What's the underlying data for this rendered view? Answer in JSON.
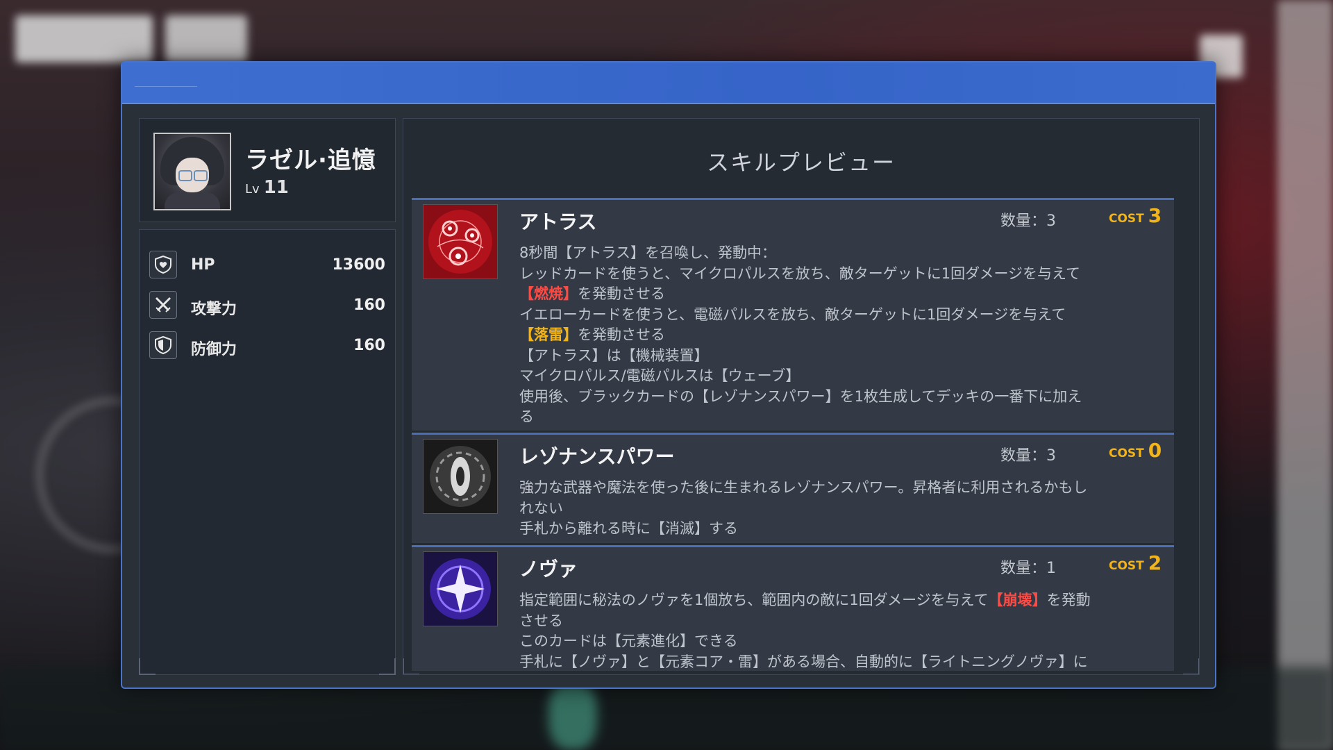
{
  "character": {
    "name": "ラゼル·追憶",
    "level_label": "Lv",
    "level": "11"
  },
  "stats": [
    {
      "icon": "heart-shield-icon",
      "label": "HP",
      "value": "13600"
    },
    {
      "icon": "crossed-swords-icon",
      "label": "攻撃力",
      "value": "160"
    },
    {
      "icon": "shield-icon",
      "label": "防御力",
      "value": "160"
    }
  ],
  "panel_title": "スキルプレビュー",
  "skills": [
    {
      "name": "アトラス",
      "qty_label": "数量：3",
      "cost_label": "COST",
      "cost": "3",
      "icon": "atlas-orbs-icon",
      "desc": {
        "l1": "8秒間【アトラス】を召喚し、発動中：",
        "l2": "レッドカードを使うと、マイクロパルスを放ち、敵ターゲットに1回ダメージを与えて",
        "l3a": "【燃焼】",
        "l3b": "を発動させる",
        "l4": "イエローカードを使うと、電磁パルスを放ち、敵ターゲットに1回ダメージを与えて",
        "l5a": "【落雷】",
        "l5b": "を発動させる",
        "l6": "【アトラス】は【機械装置】",
        "l7": "マイクロパルス/電磁パルスは【ウェーブ】",
        "l8": "使用後、ブラックカードの【レゾナンスパワー】を1枚生成してデッキの一番下に加え",
        "l9": "る"
      }
    },
    {
      "name": "レゾナンスパワー",
      "qty_label": "数量：3",
      "cost_label": "COST",
      "cost": "0",
      "icon": "resonance-eye-icon",
      "desc": {
        "l1": "強力な武器や魔法を使った後に生まれるレゾナンスパワー。昇格者に利用されるかもし",
        "l2": "れない",
        "l3": "手札から離れる時に【消滅】する"
      }
    },
    {
      "name": "ノヴァ",
      "qty_label": "数量：1",
      "cost_label": "COST",
      "cost": "2",
      "icon": "nova-star-icon",
      "desc": {
        "l1a": "指定範囲に秘法のノヴァを1個放ち、範囲内の敵に1回ダメージを与えて",
        "l1b": "【崩壊】",
        "l1c": "を発動",
        "l2": "させる",
        "l3": "このカードは【元素進化】できる",
        "l4": "手札に【ノヴァ】と【元素コア・雷】がある場合、自動的に【ライトニングノヴァ】に"
      }
    }
  ],
  "colors": {
    "accent_blue": "#3e6fd0",
    "cost_gold": "#f2b418",
    "keyword_red": "#ff4a44"
  }
}
